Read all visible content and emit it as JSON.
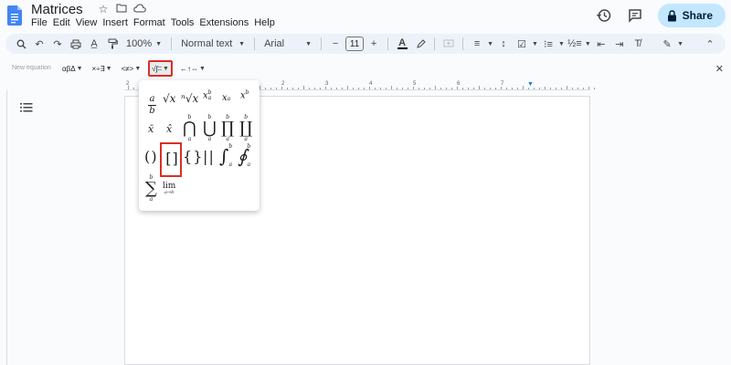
{
  "title_bar": {
    "doc_title": "Matrices",
    "menu": [
      "File",
      "Edit",
      "View",
      "Insert",
      "Format",
      "Tools",
      "Extensions",
      "Help"
    ],
    "share_label": "Share"
  },
  "toolbar": {
    "zoom": "100%",
    "style": "Normal text",
    "font": "Arial",
    "font_size": "11"
  },
  "equation_bar": {
    "new_equation_label": "New equation",
    "groups": [
      "αβΔ",
      "×÷∃",
      "<≠>",
      "√∫∶∶",
      "←↑⇔"
    ],
    "active_group_index": 3
  },
  "ruler": {
    "numbers": [
      "2",
      "1",
      "1",
      "2",
      "3",
      "4",
      "5",
      "6",
      "7"
    ]
  },
  "math_menu": {
    "symbols": [
      {
        "id": "fraction",
        "top": "a",
        "bottom": "b"
      },
      {
        "id": "sqrt",
        "text": "√x"
      },
      {
        "id": "nth-root",
        "text": "ⁿ√x"
      },
      {
        "id": "subsup",
        "base": "x",
        "sup": "b",
        "sub": "a"
      },
      {
        "id": "subscript",
        "base": "x",
        "sub": "a"
      },
      {
        "id": "superscript",
        "base": "x",
        "sup": "b"
      },
      {
        "id": "hat",
        "text": "x̄"
      },
      {
        "id": "tilde",
        "text": "x̂"
      },
      {
        "id": "intersection",
        "text": "⋂",
        "sup": "b",
        "sub": "a"
      },
      {
        "id": "union",
        "text": "⋃",
        "sup": "b",
        "sub": "a"
      },
      {
        "id": "product",
        "text": "∏",
        "sup": "b",
        "sub": "a"
      },
      {
        "id": "coproduct",
        "text": "∐",
        "sup": "b",
        "sub": "a"
      },
      {
        "id": "parentheses",
        "text": "( )"
      },
      {
        "id": "brackets",
        "text": "[ ]"
      },
      {
        "id": "braces",
        "text": "{ }"
      },
      {
        "id": "abs",
        "text": "| |"
      },
      {
        "id": "integral",
        "text": "∫",
        "sup": "b",
        "sub": "a"
      },
      {
        "id": "contour-integral",
        "text": "∮",
        "sup": "b",
        "sub": "a"
      },
      {
        "id": "summation",
        "text": "∑",
        "sup": "b",
        "sub": "a"
      },
      {
        "id": "limit",
        "text": "lim",
        "sub": "a→b"
      }
    ],
    "selected": "brackets"
  }
}
